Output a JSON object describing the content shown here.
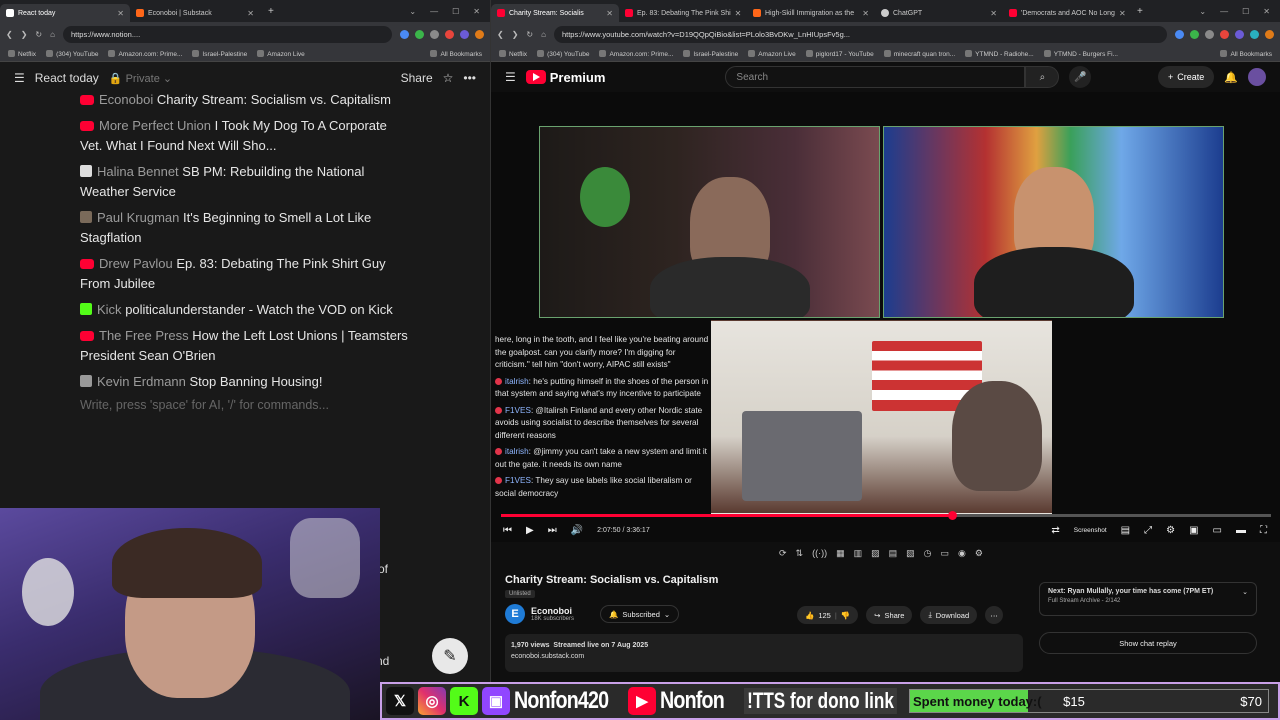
{
  "left_browser": {
    "tabs": [
      {
        "title": "React today",
        "favicon_color": "#ffffff",
        "active": true
      },
      {
        "title": "Econoboi | Substack",
        "favicon_color": "#ff6719",
        "active": false
      }
    ],
    "url": "https://www.notion....",
    "bookmarks": [
      "Netflix",
      "(304) YouTube",
      "Amazon.com: Prime...",
      "Israel-Palestine",
      "Amazon Live"
    ],
    "bookmarks_folder": "All Bookmarks"
  },
  "notion": {
    "page_title": "React today",
    "privacy": "Private",
    "share_label": "Share",
    "items": [
      {
        "source": "Econoboi",
        "title": "Charity Stream: Socialism vs. Capitalism",
        "icon": "youtube-icon"
      },
      {
        "source": "More Perfect Union",
        "title": "I Took My Dog To A Corporate Vet. What I Found Next Will Sho...",
        "icon": "youtube-icon"
      },
      {
        "source": "Halina Bennet",
        "title": "SB PM: Rebuilding the National Weather Service",
        "icon": "substack-icon"
      },
      {
        "source": "Paul Krugman",
        "title": "It's Beginning to Smell a Lot Like Stagflation",
        "icon": "substack-icon"
      },
      {
        "source": "Drew Pavlou",
        "title": "Ep. 83: Debating The Pink Shirt Guy From Jubilee",
        "icon": "youtube-icon"
      },
      {
        "source": "Kick",
        "title": "politicalunderstander - Watch the VOD on Kick",
        "icon": "kick-icon"
      },
      {
        "source": "The Free Press",
        "title": "How the Left Lost Unions | Teamsters President Sean O'Brien",
        "icon": "youtube-icon"
      },
      {
        "source": "Kevin Erdmann",
        "title": "Stop Banning Housing!",
        "icon": "substack-icon"
      }
    ],
    "placeholder": "Write, press 'space' for AI, '/' for commands...",
    "partial_text_1": "of",
    "partial_text_2": "nd"
  },
  "right_browser": {
    "tabs": [
      {
        "title": "Charity Stream: Socialis",
        "favicon_color": "#ff0033",
        "active": true
      },
      {
        "title": "Ep. 83: Debating The Pink Shi",
        "favicon_color": "#ff0033",
        "active": false
      },
      {
        "title": "High-Skill Immigration as the",
        "favicon_color": "#ff6719",
        "active": false
      },
      {
        "title": "ChatGPT",
        "favicon_color": "#cccccc",
        "active": false
      },
      {
        "title": "'Democrats and AOC No Long",
        "favicon_color": "#ff0033",
        "active": false
      }
    ],
    "url": "https://www.youtube.com/watch?v=D19QQpQiBio&list=PLolo3BvDKw_LnHIUpsFv5g...",
    "bookmarks": [
      "Netflix",
      "(304) YouTube",
      "Amazon.com: Prime...",
      "Israel-Palestine",
      "Amazon Live",
      "piglord17 - YouTube",
      "minecraft quan tron...",
      "YTMND - Radiohe...",
      "YTMND - Burgers Fi..."
    ],
    "bookmarks_folder": "All Bookmarks"
  },
  "youtube": {
    "logo_text": "Premium",
    "search_placeholder": "Search",
    "create_label": "Create",
    "chat_lines": [
      {
        "user": "",
        "text": "here, long in the tooth, and I feel like you're beating around the goalpost. can you clarify more? I'm digging for criticism.\" tell him \"don't worry, AIPAC still exists\""
      },
      {
        "user": "italrish",
        "text": "he's putting himself in the shoes of the person in that system and saying what's my incentive to participate"
      },
      {
        "user": "F1VES",
        "text": "@Italirsh Finland and every other Nordic state avoids using socialist to describe themselves for several different reasons"
      },
      {
        "user": "italrish",
        "text": "@jimmy you can't take a new system and limit it out the gate. it needs its own name"
      },
      {
        "user": "F1VES",
        "text": "They say use labels like social liberalism or social democracy"
      }
    ],
    "time_current": "2:07:50",
    "time_total": "3:36:17",
    "progress": 0.58,
    "screenshot_label": "Screenshot",
    "video_title": "Charity Stream: Socialism vs. Capitalism",
    "unlisted": "Unlisted",
    "channel_name": "Econoboi",
    "channel_initial": "E",
    "subscribers": "18K subscribers",
    "subscribed_label": "Subscribed",
    "likes": "125",
    "share_label": "Share",
    "download_label": "Download",
    "views": "1,970 views",
    "streamed": "Streamed live on 7 Aug 2025",
    "desc_link": "econoboi.substack.com",
    "next_title": "Next: Ryan Mullally, your time has come (7PM ET)",
    "next_sub": "Full Stream Archive - 2/142",
    "show_chat": "Show chat replay"
  },
  "overlay": {
    "handle1": "Nonfon420",
    "handle2": "Nonfon",
    "tts": "!TTS for dono link",
    "goal_label": "Spent money today:(",
    "goal_current": "$15",
    "goal_target": "$70",
    "goal_progress": 0.33
  }
}
